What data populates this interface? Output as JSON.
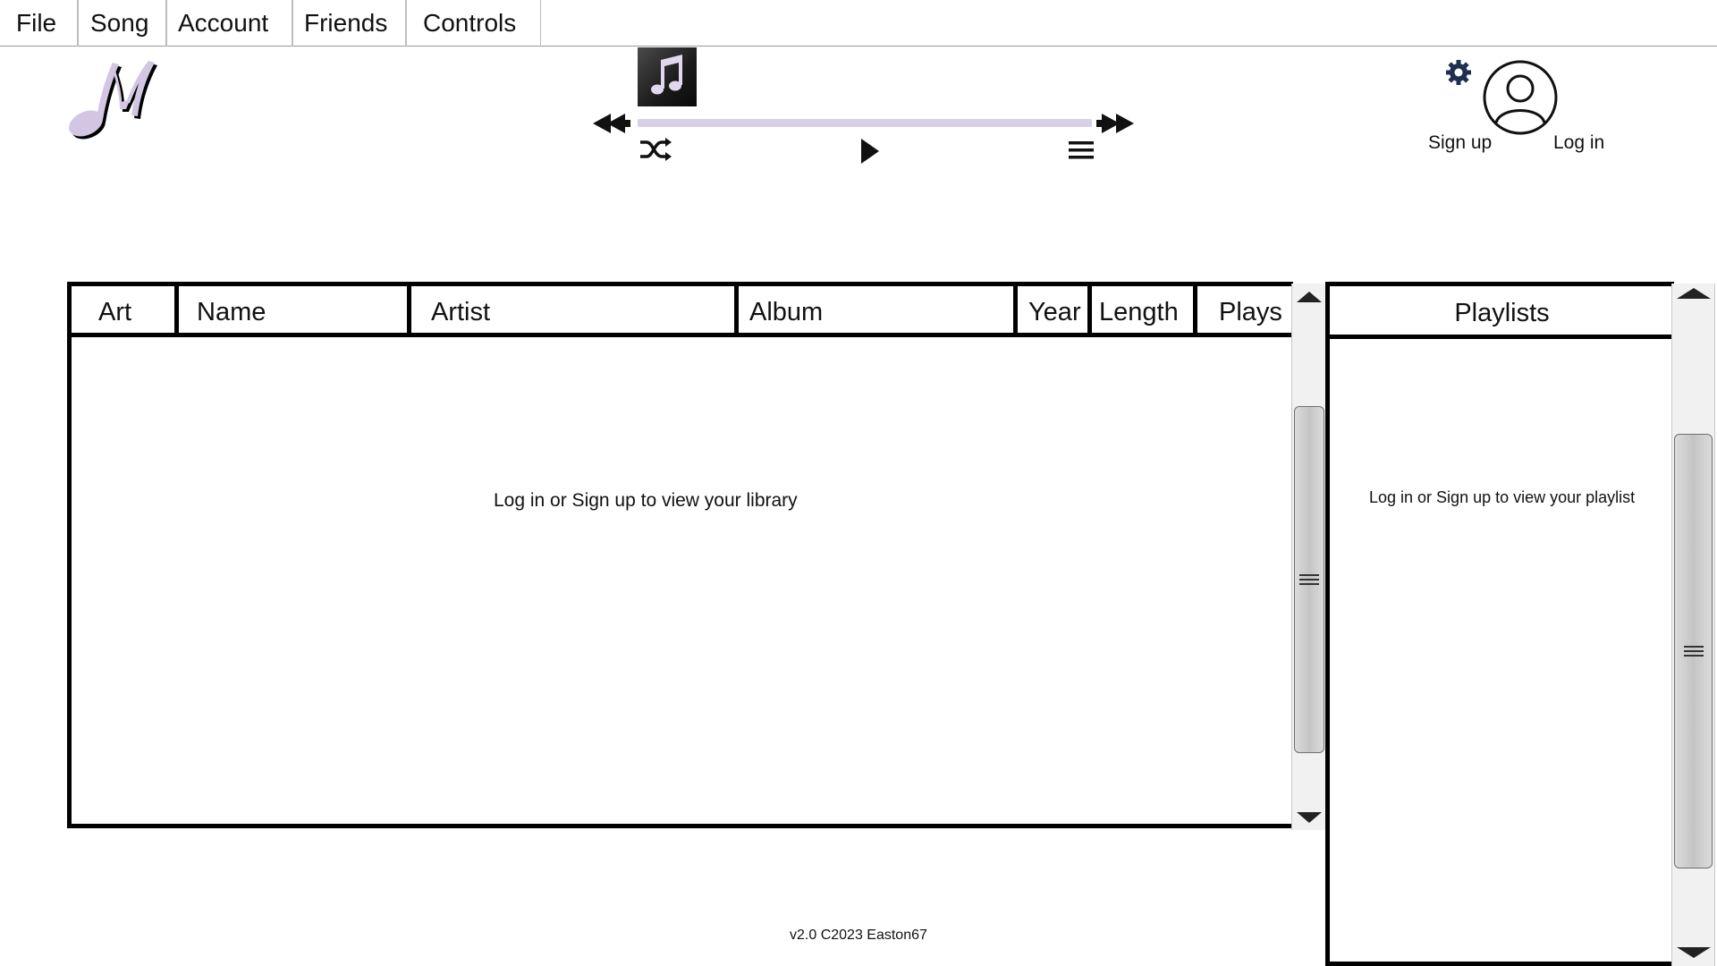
{
  "menu": {
    "items": [
      {
        "label": "File"
      },
      {
        "label": "Song"
      },
      {
        "label": "Account"
      },
      {
        "label": "Friends"
      },
      {
        "label": "Controls"
      }
    ]
  },
  "logo": {
    "icon": "music-note-m-logo",
    "color": "#d3c6e3"
  },
  "player": {
    "album_art_icon": "music-note-icon",
    "progress": 0,
    "accent": "#d8d0e6"
  },
  "account": {
    "settings_icon": "gear-icon",
    "avatar_icon": "user-avatar-icon",
    "sign_up_label": "Sign up",
    "log_in_label": "Log in"
  },
  "library": {
    "columns": [
      "Art",
      "Name",
      "Artist",
      "Album",
      "Year",
      "Length",
      "Plays"
    ],
    "empty_message": "Log in or Sign up to view your library"
  },
  "playlists": {
    "title": "Playlists",
    "empty_message": "Log in or Sign up to view your playlist"
  },
  "footer": {
    "version_text": "v2.0 C2023 Easton67"
  }
}
